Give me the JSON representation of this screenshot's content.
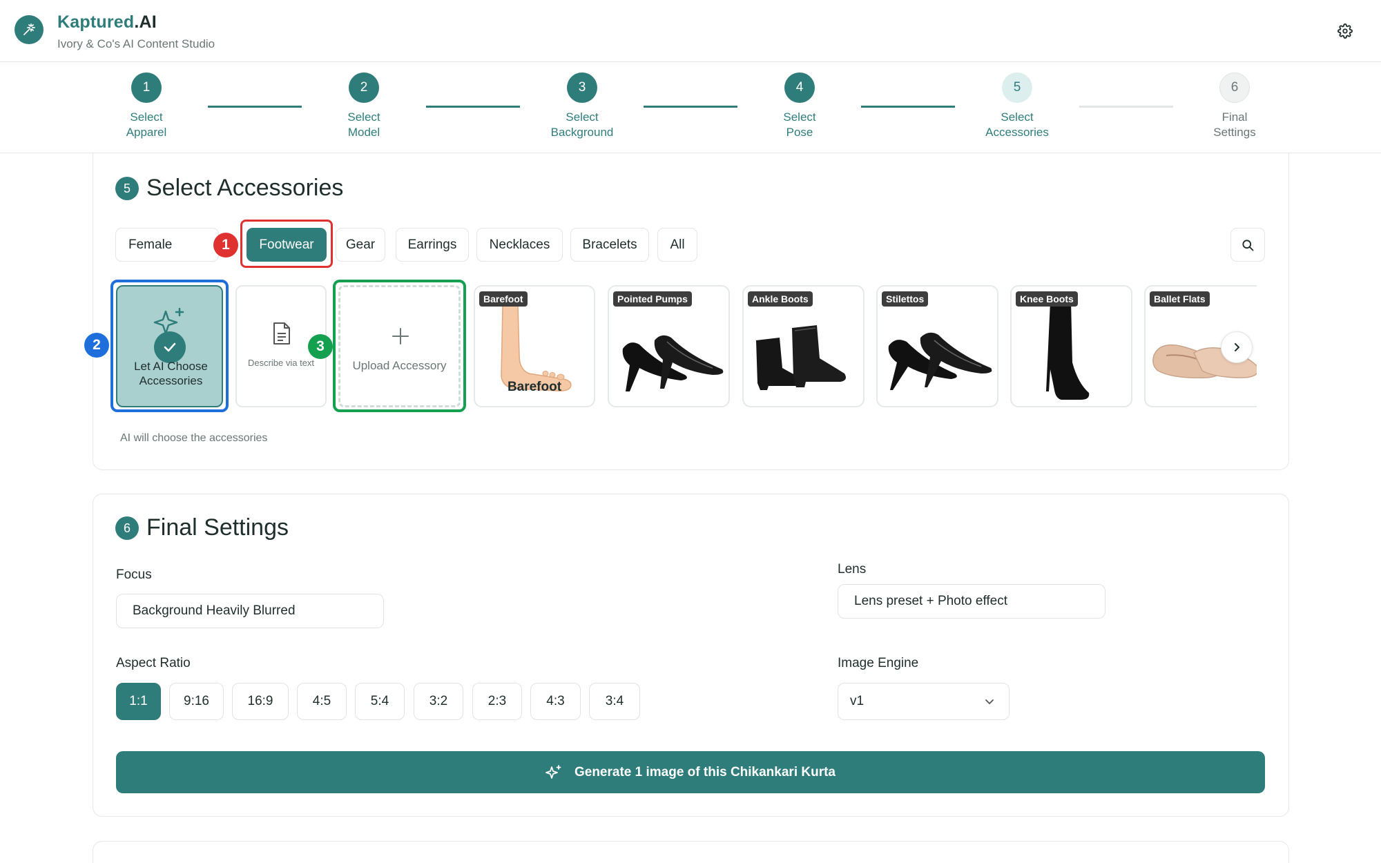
{
  "app": {
    "brand_name": "Kaptured",
    "brand_suffix": ".AI",
    "subtitle": "Ivory & Co's AI Content Studio",
    "logo_icon": "magic-wand-icon",
    "settings_icon": "gear-icon"
  },
  "stepper": {
    "steps": [
      {
        "num": "1",
        "label_1": "Select",
        "label_2": "Apparel",
        "state": "done"
      },
      {
        "num": "2",
        "label_1": "Select",
        "label_2": "Model",
        "state": "done"
      },
      {
        "num": "3",
        "label_1": "Select",
        "label_2": "Background",
        "state": "done"
      },
      {
        "num": "4",
        "label_1": "Select",
        "label_2": "Pose",
        "state": "done"
      },
      {
        "num": "5",
        "label_1": "Select",
        "label_2": "Accessories",
        "state": "current"
      },
      {
        "num": "6",
        "label_1": "Final",
        "label_2": "Settings",
        "state": "future"
      }
    ]
  },
  "accessories": {
    "num": "5",
    "title": "Select Accessories",
    "gender": "Female",
    "categories": [
      "Footwear",
      "Gear",
      "Earrings",
      "Necklaces",
      "Bracelets",
      "All"
    ],
    "active_category": "Footwear",
    "ai_choose_label": "Let AI Choose Accessories",
    "describe_label": "Describe via text",
    "upload_label": "Upload Accessory",
    "items": [
      {
        "tag": "Barefoot",
        "caption": "Barefoot"
      },
      {
        "tag": "Pointed Pumps"
      },
      {
        "tag": "Ankle Boots"
      },
      {
        "tag": "Stilettos"
      },
      {
        "tag": "Knee Boots"
      },
      {
        "tag": "Ballet Flats"
      }
    ],
    "hint": "AI will choose the accessories",
    "annotations": [
      "1",
      "2",
      "3"
    ]
  },
  "final_settings": {
    "num": "6",
    "title": "Final Settings",
    "focus_label": "Focus",
    "focus_value": "Background Heavily Blurred",
    "lens_label": "Lens",
    "lens_value": "Lens preset + Photo effect",
    "aspect_label": "Aspect Ratio",
    "aspect_ratios": [
      "1:1",
      "9:16",
      "16:9",
      "4:5",
      "5:4",
      "3:2",
      "2:3",
      "4:3",
      "3:4"
    ],
    "active_ratio": "1:1",
    "engine_label": "Image Engine",
    "engine_value": "v1",
    "generate_label": "Generate 1 image of this Chikankari Kurta"
  },
  "colors": {
    "primary": "#2f7d7b",
    "annotation_red": "#e03131",
    "annotation_blue": "#1e6fdc",
    "annotation_green": "#15a050"
  }
}
